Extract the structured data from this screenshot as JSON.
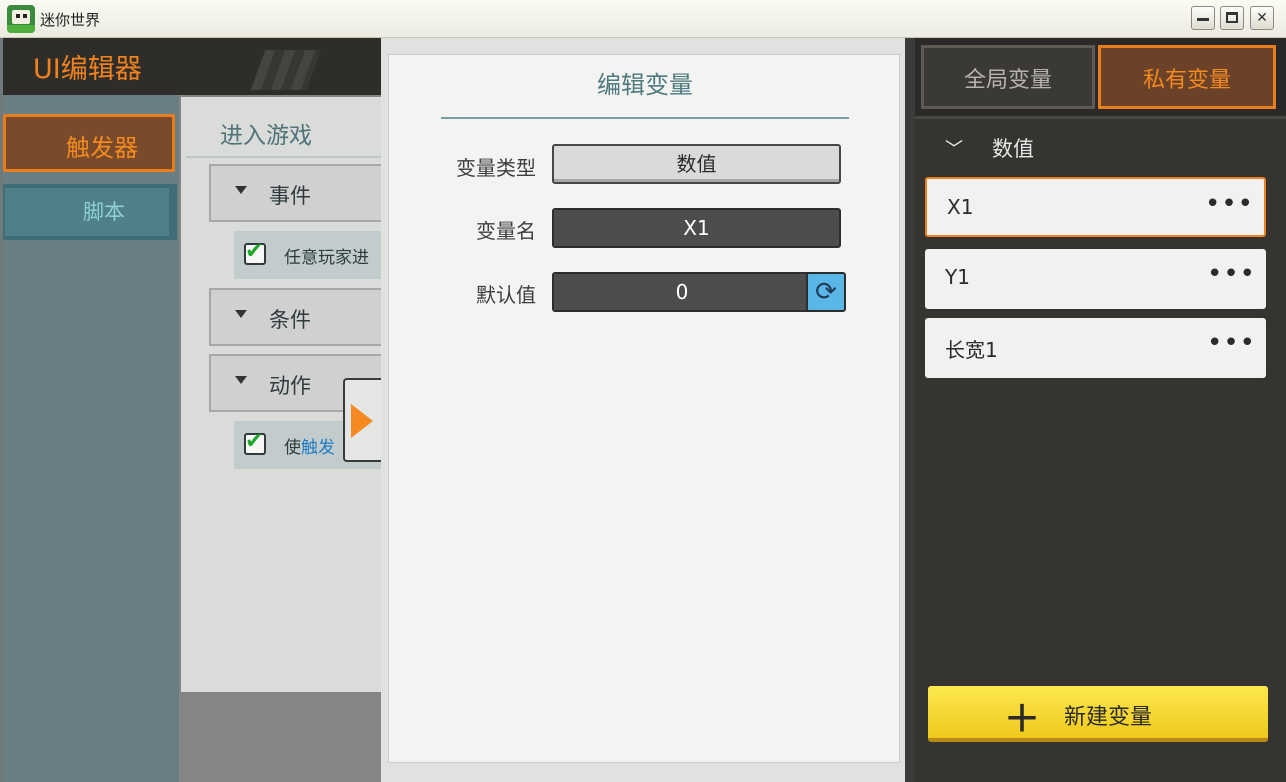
{
  "window": {
    "title": "迷你世界"
  },
  "editor": {
    "title": "UI编辑器"
  },
  "left_tabs": [
    {
      "label": "触发器",
      "active": true
    },
    {
      "label": "脚本",
      "active": false
    }
  ],
  "trigger": {
    "name": "进入游戏",
    "groups": [
      {
        "label": "事件"
      },
      {
        "label": "条件"
      },
      {
        "label": "动作"
      }
    ],
    "event_item": {
      "label": "任意玩家进",
      "checked": true
    },
    "action_item": {
      "prefix": "使",
      "highlight": "触发",
      "checked": true
    }
  },
  "dialog": {
    "title": "编辑变量",
    "type_label": "变量类型",
    "type_value": "数值",
    "name_label": "变量名",
    "name_value": "X1",
    "default_label": "默认值",
    "default_value": "0"
  },
  "right_panel": {
    "tabs": [
      {
        "label": "全局变量",
        "active": false
      },
      {
        "label": "私有变量",
        "active": true
      }
    ],
    "category": "数值",
    "variables": [
      {
        "name": "X1",
        "selected": true
      },
      {
        "name": "Y1",
        "selected": false
      },
      {
        "name": "长宽1",
        "selected": false
      }
    ],
    "more_glyph": "•••",
    "new_button": "新建变量"
  },
  "colors": {
    "accent_orange": "#f0821e",
    "teal": "#4f7a80",
    "new_button_yellow": "#f7dc30"
  }
}
